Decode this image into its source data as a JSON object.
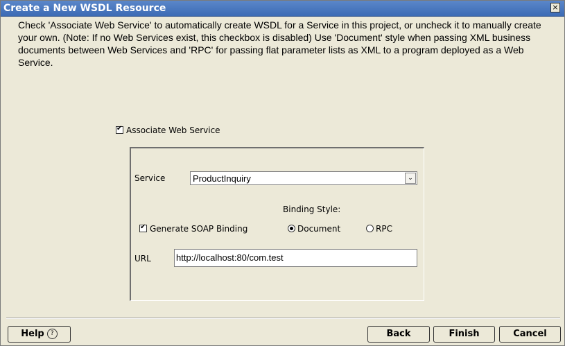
{
  "window": {
    "title": "Create a New WSDL Resource",
    "close_symbol": "×"
  },
  "description": "Check 'Associate Web Service' to automatically create WSDL for a Service in this project, or uncheck it to manually create your own. (Note: If no Web Services exist, this checkbox is disabled) Use 'Document' style when passing XML business documents between Web Services and 'RPC' for passing flat parameter lists as XML to a program deployed as a Web Service.",
  "associate": {
    "label": "Associate Web Service",
    "checked": true
  },
  "service": {
    "label": "Service",
    "value": "ProductInquiry",
    "arrow": "⌄"
  },
  "binding": {
    "style_label": "Binding Style:",
    "generate_soap_label": "Generate SOAP Binding",
    "generate_soap_checked": true,
    "document_label": "Document",
    "rpc_label": "RPC",
    "selected": "Document"
  },
  "url": {
    "label": "URL",
    "value": "http://localhost:80/com.test"
  },
  "buttons": {
    "help": "Help",
    "help_icon": "?",
    "back": "Back",
    "finish": "Finish",
    "cancel": "Cancel"
  },
  "icons": [
    "close-icon",
    "checkbox-icon",
    "dropdown-arrow-icon",
    "radio-icon",
    "help-icon"
  ]
}
